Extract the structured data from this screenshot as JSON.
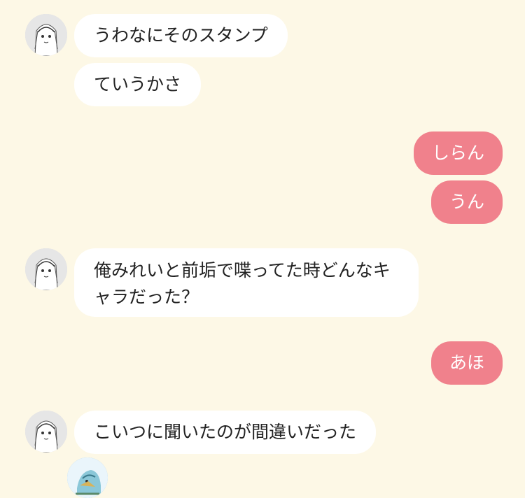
{
  "colors": {
    "background": "#fdf8e6",
    "incoming_bubble": "#ffffff",
    "outgoing_bubble": "#f0818c"
  },
  "messages": [
    {
      "side": "in",
      "text": "うわなにそのスタンプ"
    },
    {
      "side": "in",
      "text": "ていうかさ"
    },
    {
      "side": "out",
      "text": "しらん"
    },
    {
      "side": "out",
      "text": "うん"
    },
    {
      "side": "in",
      "text": "俺みれいと前垢で喋ってた時どんなキャラだった？"
    },
    {
      "side": "out",
      "text": "あほ"
    },
    {
      "side": "in",
      "text": "こいつに聞いたのが間違いだった"
    }
  ]
}
